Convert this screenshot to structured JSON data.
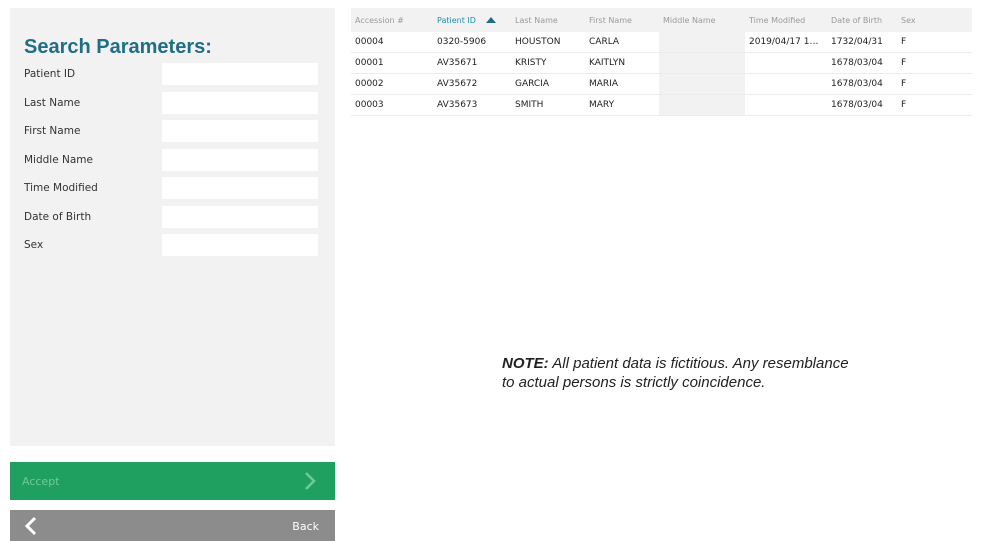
{
  "search": {
    "title": "Search Parameters:",
    "fields": [
      {
        "label": "Patient ID",
        "value": ""
      },
      {
        "label": "Last Name",
        "value": ""
      },
      {
        "label": "First Name",
        "value": ""
      },
      {
        "label": "Middle Name",
        "value": ""
      },
      {
        "label": "Time Modified",
        "value": ""
      },
      {
        "label": "Date of Birth",
        "value": ""
      },
      {
        "label": "Sex",
        "value": ""
      }
    ]
  },
  "buttons": {
    "accept_label": "Accept",
    "back_label": "Back"
  },
  "table": {
    "columns": [
      "Accession #",
      "Patient ID",
      "Last Name",
      "First Name",
      "Middle Name",
      "Time Modified",
      "Date of Birth",
      "Sex"
    ],
    "sorted_column": "Patient ID",
    "rows": [
      [
        "00004",
        "0320-5906",
        "HOUSTON",
        "CARLA",
        "",
        "2019/04/17 17:35...",
        "1732/04/31",
        "F"
      ],
      [
        "00001",
        "AV35671",
        "KRISTY",
        "KAITLYN",
        "",
        "",
        "1678/03/04",
        "F"
      ],
      [
        "00002",
        "AV35672",
        "GARCIA",
        "MARIA",
        "",
        "",
        "1678/03/04",
        "F"
      ],
      [
        "00003",
        "AV35673",
        "SMITH",
        "MARY",
        "",
        "",
        "1678/03/04",
        "F"
      ]
    ]
  },
  "note": {
    "prefix": "NOTE:",
    "text": " All patient data is fictitious. Any resemblance to actual persons is strictly coincidence."
  },
  "colors": {
    "title": "#1f6e86",
    "accept": "#20a060",
    "back": "#8c8c8c",
    "panel": "#f2f2f2"
  },
  "icons": {
    "accept": "chevron-right-icon",
    "back": "chevron-left-icon",
    "sort": "sort-ascending-icon"
  }
}
